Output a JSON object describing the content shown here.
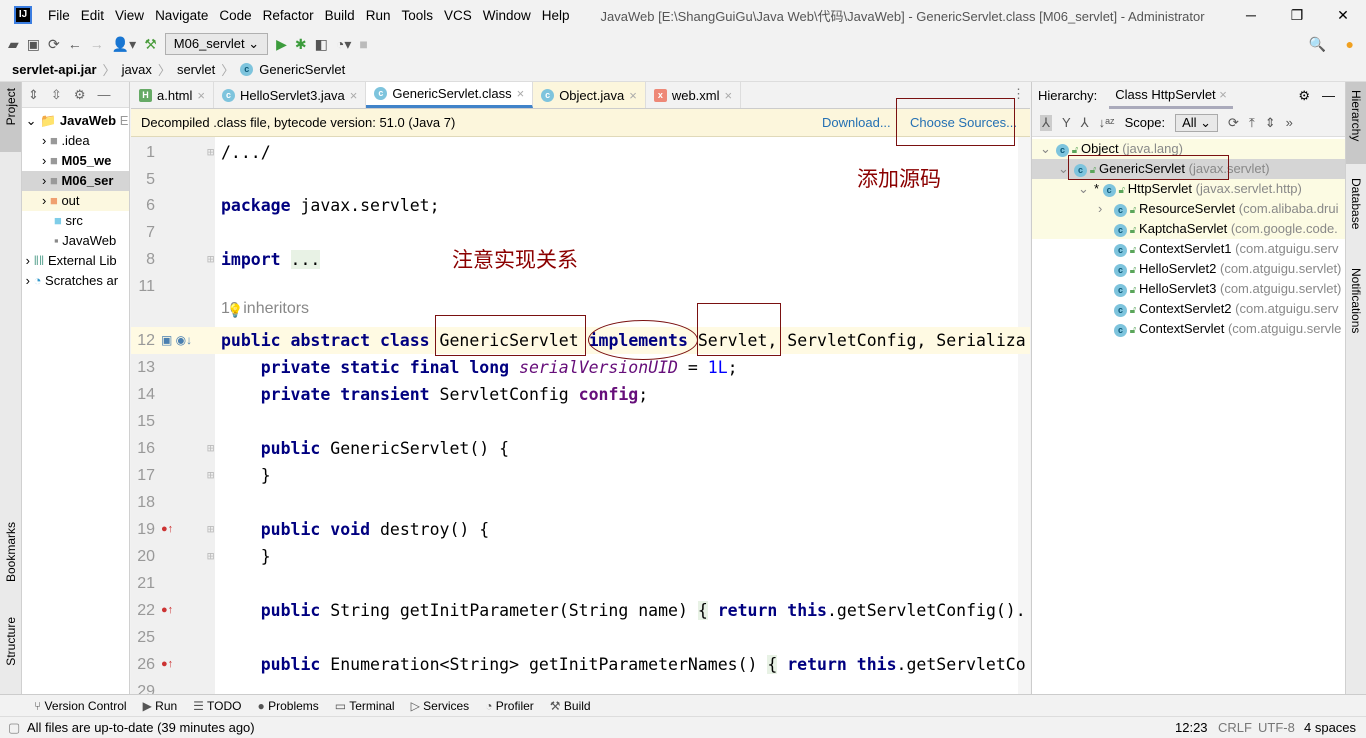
{
  "menubar": {
    "items": [
      "File",
      "Edit",
      "View",
      "Navigate",
      "Code",
      "Refactor",
      "Build",
      "Run",
      "Tools",
      "VCS",
      "Window",
      "Help"
    ],
    "title": "JavaWeb [E:\\ShangGuiGu\\Java Web\\代码\\JavaWeb] - GenericServlet.class [M06_servlet] - Administrator"
  },
  "toolbar": {
    "run_config": "M06_servlet"
  },
  "breadcrumb": [
    "servlet-api.jar",
    "javax",
    "servlet",
    "GenericServlet"
  ],
  "left_strip": {
    "project": "Project",
    "bookmarks": "Bookmarks",
    "structure": "Structure"
  },
  "right_strip": {
    "hierarchy": "Hierarchy",
    "database": "Database",
    "notifications": "Notifications"
  },
  "project_tree": [
    "JavaWeb",
    "E",
    "​.idea",
    "M05_we",
    "M06_ser",
    "out",
    "src",
    "JavaWeb",
    "External Lib",
    "Scratches ar"
  ],
  "tabs": [
    "a.html",
    "HelloServlet3.java",
    "GenericServlet.class",
    "Object.java",
    "web.xml"
  ],
  "banner": {
    "text": "Decompiled .class file, bytecode version: 51.0 (Java 7)",
    "download": "Download...",
    "choose": "Choose Sources..."
  },
  "code": {
    "inheritors": "10 inheritors",
    "lines": [
      {
        "n": "1",
        "t": [
          [
            "/.../",
            ""
          ]
        ]
      },
      {
        "n": "5",
        "t": []
      },
      {
        "n": "6",
        "t": [
          [
            "package",
            "kw"
          ],
          [
            " javax.servlet;",
            ""
          ]
        ]
      },
      {
        "n": "7",
        "t": []
      },
      {
        "n": "8",
        "t": [
          [
            "import",
            "kw"
          ],
          [
            " ",
            ""
          ],
          [
            "...",
            "fold"
          ]
        ]
      },
      {
        "n": "11",
        "t": []
      },
      {
        "n": "12",
        "t": [
          [
            "public abstract class",
            "kw"
          ],
          [
            " GenericServlet ",
            ""
          ],
          [
            "implements",
            "kw"
          ],
          [
            " Servlet, ServletConfig, Serializa",
            ""
          ]
        ]
      },
      {
        "n": "13",
        "t": [
          [
            "    private static final long",
            "kw"
          ],
          [
            " ",
            ""
          ],
          [
            "serialVersionUID",
            "sfld"
          ],
          [
            " = ",
            ""
          ],
          [
            "1L",
            "num"
          ],
          [
            ";",
            ""
          ]
        ]
      },
      {
        "n": "14",
        "t": [
          [
            "    private transient",
            "kw"
          ],
          [
            " ServletConfig ",
            ""
          ],
          [
            "config",
            "fld"
          ],
          [
            ";",
            ""
          ]
        ]
      },
      {
        "n": "15",
        "t": []
      },
      {
        "n": "16",
        "t": [
          [
            "    public",
            "kw"
          ],
          [
            " GenericServlet() {",
            ""
          ]
        ]
      },
      {
        "n": "17",
        "t": [
          [
            "    }",
            ""
          ]
        ]
      },
      {
        "n": "18",
        "t": []
      },
      {
        "n": "19",
        "t": [
          [
            "    public void",
            "kw"
          ],
          [
            " destroy() {",
            ""
          ]
        ]
      },
      {
        "n": "20",
        "t": [
          [
            "    }",
            ""
          ]
        ]
      },
      {
        "n": "21",
        "t": []
      },
      {
        "n": "22",
        "t": [
          [
            "    public",
            "kw"
          ],
          [
            " String getInitParameter(String name) ",
            ""
          ],
          [
            "{",
            "fold"
          ],
          [
            " ",
            ""
          ],
          [
            "return this",
            "kw"
          ],
          [
            ".getServletConfig().",
            ""
          ]
        ]
      },
      {
        "n": "25",
        "t": []
      },
      {
        "n": "26",
        "t": [
          [
            "    public",
            "kw"
          ],
          [
            " Enumeration<String> getInitParameterNames() ",
            ""
          ],
          [
            "{",
            "fold"
          ],
          [
            " ",
            ""
          ],
          [
            "return this",
            "kw"
          ],
          [
            ".getServletCo",
            ""
          ]
        ]
      },
      {
        "n": "29",
        "t": []
      }
    ]
  },
  "hierarchy": {
    "label": "Hierarchy:",
    "tab": "Class HttpServlet",
    "scope_label": "Scope:",
    "scope": "All",
    "rows": [
      {
        "name": "Object",
        "pkg": "(java.lang)"
      },
      {
        "name": "GenericServlet",
        "pkg": "(javax.servlet)"
      },
      {
        "name": "HttpServlet",
        "pkg": "(javax.servlet.http)"
      },
      {
        "name": "ResourceServlet",
        "pkg": "(com.alibaba.drui"
      },
      {
        "name": "KaptchaServlet",
        "pkg": "(com.google.code."
      },
      {
        "name": "ContextServlet1",
        "pkg": "(com.atguigu.serv"
      },
      {
        "name": "HelloServlet2",
        "pkg": "(com.atguigu.servlet)"
      },
      {
        "name": "HelloServlet3",
        "pkg": "(com.atguigu.servlet)"
      },
      {
        "name": "ContextServlet2",
        "pkg": "(com.atguigu.serv"
      },
      {
        "name": "ContextServlet",
        "pkg": "(com.atguigu.servle"
      }
    ]
  },
  "bottom_tabs": [
    "Version Control",
    "Run",
    "TODO",
    "Problems",
    "Terminal",
    "Services",
    "Profiler",
    "Build"
  ],
  "status": {
    "message": "All files are up-to-date (39 minutes ago)",
    "position": "12:23",
    "line_sep": "CRLF",
    "encoding": "UTF-8",
    "indent": "4 spaces"
  },
  "annotations": {
    "add_source": "添加源码",
    "note_impl": "注意实现关系"
  }
}
